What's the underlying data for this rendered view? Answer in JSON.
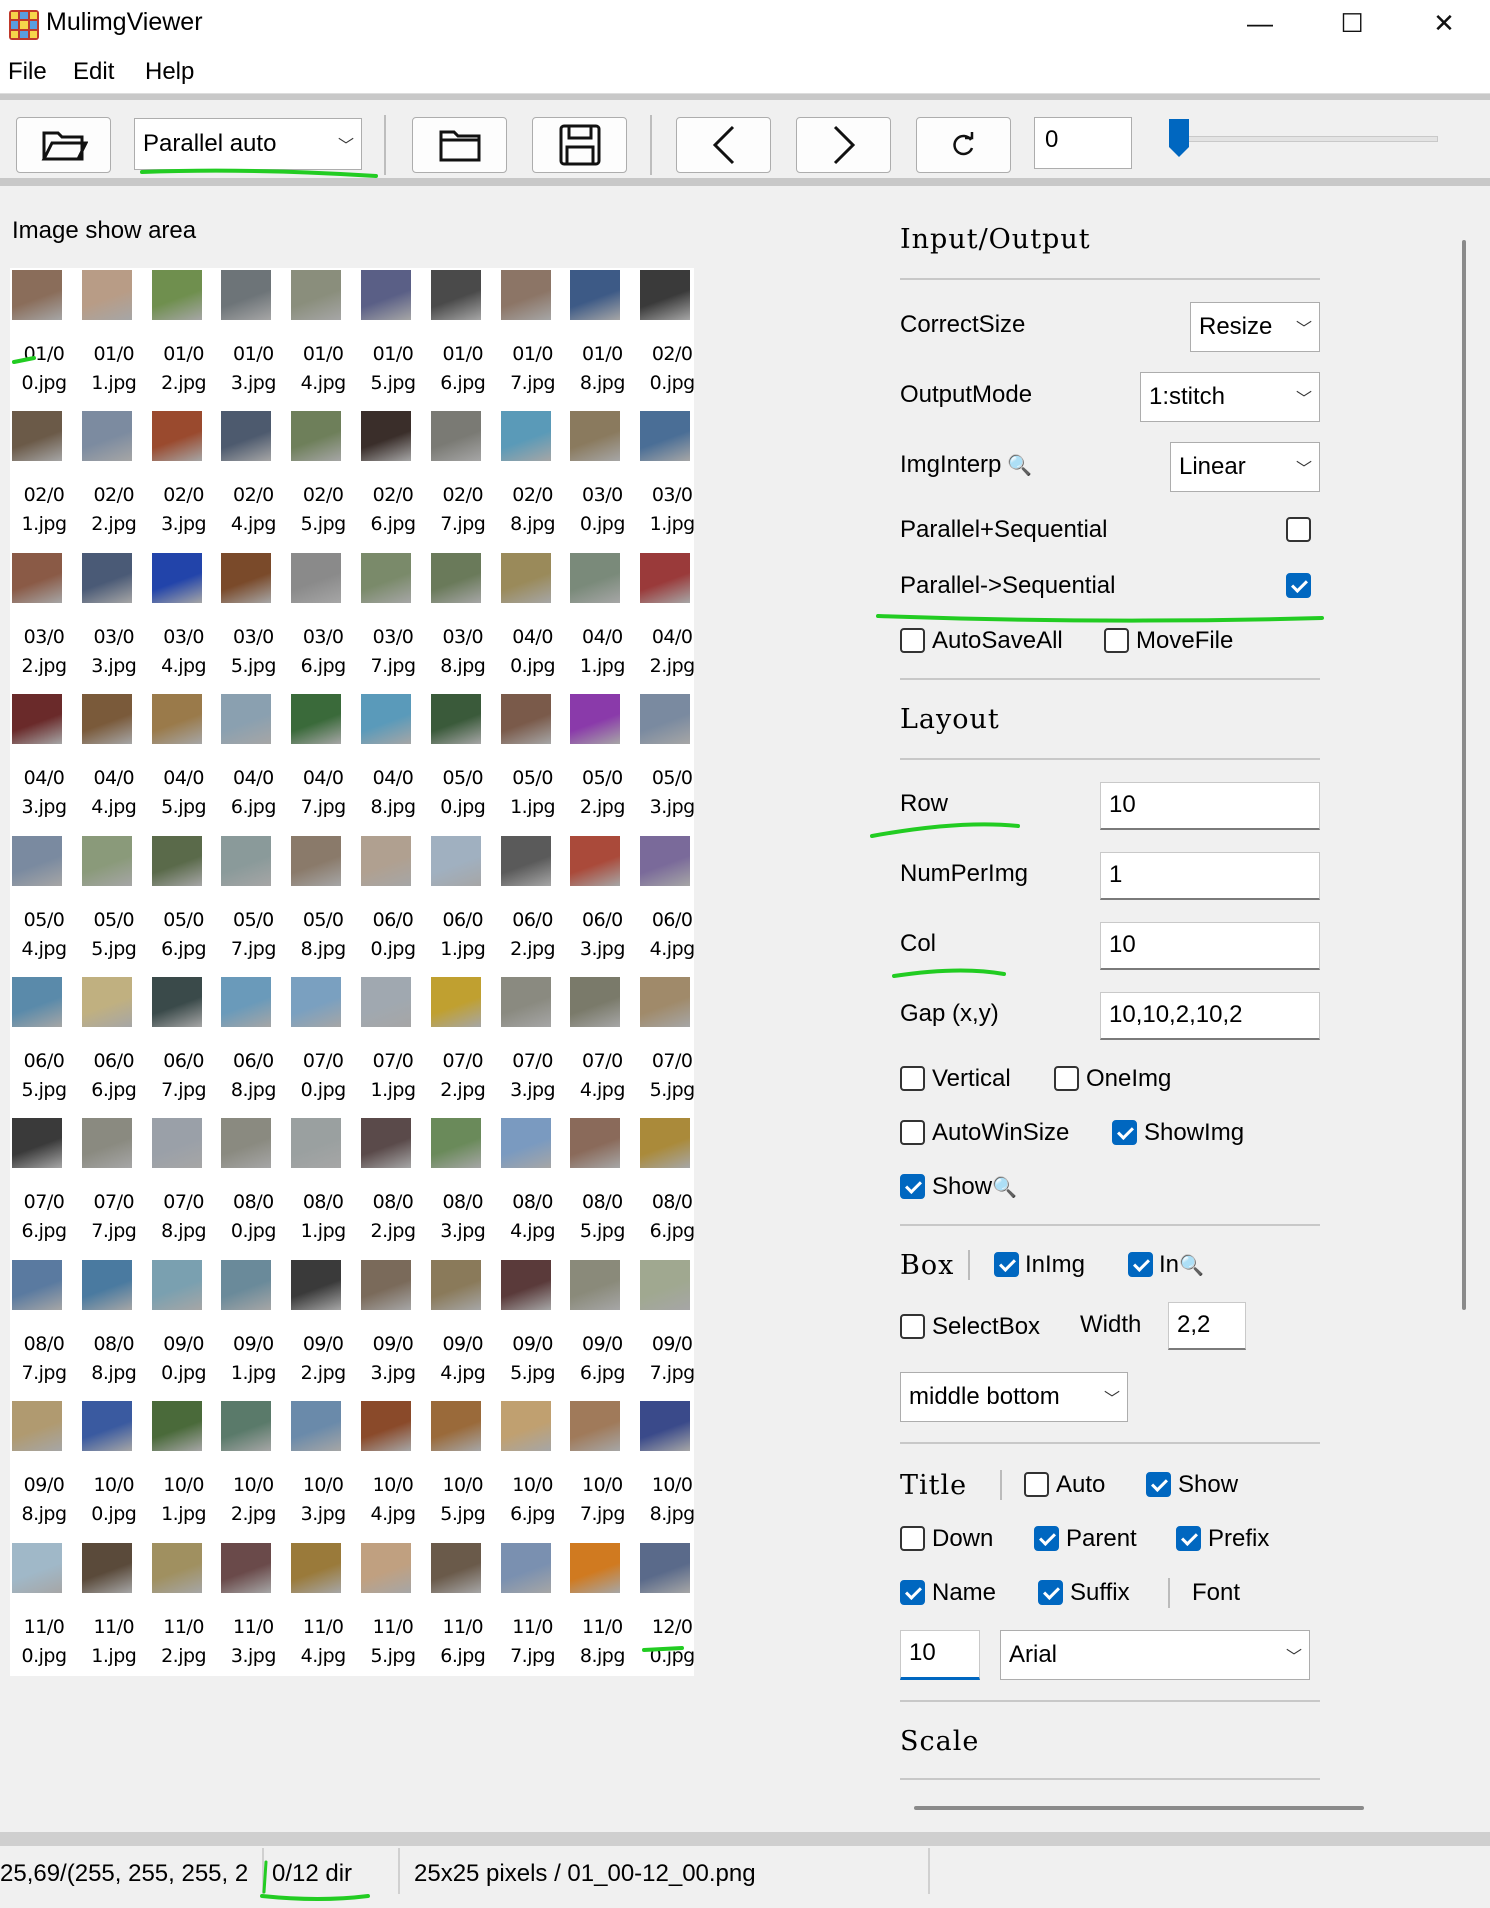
{
  "window": {
    "title": "MulimgViewer",
    "minimize": "—",
    "maximize": "☐",
    "close": "✕"
  },
  "menu": [
    "File",
    "Edit",
    "Help"
  ],
  "toolbar": {
    "mode_value": "Parallel auto",
    "spin_value": "0",
    "slider_level": 0.0
  },
  "image_area": {
    "label": "Image show area",
    "captions": [
      [
        "01/0\n0.jpg",
        "01/0\n1.jpg",
        "01/0\n2.jpg",
        "01/0\n3.jpg",
        "01/0\n4.jpg",
        "01/0\n5.jpg",
        "01/0\n6.jpg",
        "01/0\n7.jpg",
        "01/0\n8.jpg",
        "02/0\n0.jpg"
      ],
      [
        "02/0\n1.jpg",
        "02/0\n2.jpg",
        "02/0\n3.jpg",
        "02/0\n4.jpg",
        "02/0\n5.jpg",
        "02/0\n6.jpg",
        "02/0\n7.jpg",
        "02/0\n8.jpg",
        "03/0\n0.jpg",
        "03/0\n1.jpg"
      ],
      [
        "03/0\n2.jpg",
        "03/0\n3.jpg",
        "03/0\n4.jpg",
        "03/0\n5.jpg",
        "03/0\n6.jpg",
        "03/0\n7.jpg",
        "03/0\n8.jpg",
        "04/0\n0.jpg",
        "04/0\n1.jpg",
        "04/0\n2.jpg"
      ],
      [
        "04/0\n3.jpg",
        "04/0\n4.jpg",
        "04/0\n5.jpg",
        "04/0\n6.jpg",
        "04/0\n7.jpg",
        "04/0\n8.jpg",
        "05/0\n0.jpg",
        "05/0\n1.jpg",
        "05/0\n2.jpg",
        "05/0\n3.jpg"
      ],
      [
        "05/0\n4.jpg",
        "05/0\n5.jpg",
        "05/0\n6.jpg",
        "05/0\n7.jpg",
        "05/0\n8.jpg",
        "06/0\n0.jpg",
        "06/0\n1.jpg",
        "06/0\n2.jpg",
        "06/0\n3.jpg",
        "06/0\n4.jpg"
      ],
      [
        "06/0\n5.jpg",
        "06/0\n6.jpg",
        "06/0\n7.jpg",
        "06/0\n8.jpg",
        "07/0\n0.jpg",
        "07/0\n1.jpg",
        "07/0\n2.jpg",
        "07/0\n3.jpg",
        "07/0\n4.jpg",
        "07/0\n5.jpg"
      ],
      [
        "07/0\n6.jpg",
        "07/0\n7.jpg",
        "07/0\n8.jpg",
        "08/0\n0.jpg",
        "08/0\n1.jpg",
        "08/0\n2.jpg",
        "08/0\n3.jpg",
        "08/0\n4.jpg",
        "08/0\n5.jpg",
        "08/0\n6.jpg"
      ],
      [
        "08/0\n7.jpg",
        "08/0\n8.jpg",
        "09/0\n0.jpg",
        "09/0\n1.jpg",
        "09/0\n2.jpg",
        "09/0\n3.jpg",
        "09/0\n4.jpg",
        "09/0\n5.jpg",
        "09/0\n6.jpg",
        "09/0\n7.jpg"
      ],
      [
        "09/0\n8.jpg",
        "10/0\n0.jpg",
        "10/0\n1.jpg",
        "10/0\n2.jpg",
        "10/0\n3.jpg",
        "10/0\n4.jpg",
        "10/0\n5.jpg",
        "10/0\n6.jpg",
        "10/0\n7.jpg",
        "10/0\n8.jpg"
      ],
      [
        "11/0\n0.jpg",
        "11/0\n1.jpg",
        "11/0\n2.jpg",
        "11/0\n3.jpg",
        "11/0\n4.jpg",
        "11/0\n5.jpg",
        "11/0\n6.jpg",
        "11/0\n7.jpg",
        "11/0\n8.jpg",
        "12/0\n0.jpg"
      ]
    ],
    "thumb_colors": [
      [
        "#8a6d5a",
        "#b89c86",
        "#6f8f4e",
        "#6d7478",
        "#8a8e7c",
        "#5a5f86",
        "#4a4a4a",
        "#8c7566",
        "#3d5a86",
        "#3a3a3a"
      ],
      [
        "#6b5a48",
        "#7c8ba0",
        "#9a4a2e",
        "#4d5a6e",
        "#6e7f5a",
        "#3a2e2a",
        "#7a7a74",
        "#5a9ab8",
        "#8a7a5e",
        "#4a6e96"
      ],
      [
        "#8a5a46",
        "#4a5a76",
        "#2244aa",
        "#7a4a2a",
        "#8a8a8a",
        "#7a8a6a",
        "#6a7a5a",
        "#9a8a5a",
        "#7a8a7a",
        "#9a3a3a"
      ],
      [
        "#6a2a2a",
        "#7a5a3a",
        "#9a7a4a",
        "#8aa0b0",
        "#3a6a3a",
        "#5a9aba",
        "#3a5a3a",
        "#7a5a4a",
        "#8a3aaa",
        "#7a8aa0"
      ],
      [
        "#7a8aa0",
        "#8a9a7a",
        "#5a6a4a",
        "#8a9a9a",
        "#8a7a6a",
        "#b0a090",
        "#a0b0c0",
        "#5a5a5a",
        "#aa4a3a",
        "#7a6a9a"
      ],
      [
        "#5a8aaa",
        "#c0b080",
        "#3a4a4a",
        "#6a9aba",
        "#7aa0c0",
        "#a0a8b0",
        "#c0a030",
        "#8a8a80",
        "#7a7a6a",
        "#a08a6a"
      ],
      [
        "#3a3a3a",
        "#8a8a80",
        "#9aa0a8",
        "#8a8a80",
        "#9aa0a0",
        "#5a4a4a",
        "#6a8a5a",
        "#7a9ac0",
        "#8a6a5a",
        "#aa8a3a"
      ],
      [
        "#5a7aa0",
        "#4a7aa0",
        "#7aa0b0",
        "#6a8a9a",
        "#3a3a3a",
        "#7a6a5a",
        "#8a7a5a",
        "#5a3a3a",
        "#8a8a7a",
        "#a0a890"
      ],
      [
        "#b09a70",
        "#3a5aa0",
        "#4a6a3a",
        "#5a7a6a",
        "#6a8aaa",
        "#8a4a2a",
        "#9a6a3a",
        "#c0a070",
        "#a07a5a",
        "#3a4a8a"
      ],
      [
        "#a0b8c8",
        "#5a4a3a",
        "#a09060",
        "#6a4a4a",
        "#9a7a3a",
        "#c0a080",
        "#6a5a4a",
        "#7a90b0",
        "#d07a20",
        "#5a6a8a"
      ]
    ]
  },
  "panel": {
    "io_title": "Input/Output",
    "correct_size_label": "CorrectSize",
    "correct_size_value": "Resize",
    "output_mode_label": "OutputMode",
    "output_mode_value": "1:stitch",
    "img_interp_label": "ImgInterp",
    "img_interp_value": "Linear",
    "par_seq_label": "Parallel+Sequential",
    "par_seq_checked": false,
    "par_to_seq_label": "Parallel->Sequential",
    "par_to_seq_checked": true,
    "autosaveall_label": "AutoSaveAll",
    "autosaveall_checked": false,
    "movefile_label": "MoveFile",
    "movefile_checked": false,
    "layout_title": "Layout",
    "row_label": "Row",
    "row_value": "10",
    "numperimg_label": "NumPerImg",
    "numperimg_value": "1",
    "col_label": "Col",
    "col_value": "10",
    "gap_label": "Gap (x,y)",
    "gap_value": "10,10,2,10,2",
    "vertical_label": "Vertical",
    "vertical_checked": false,
    "oneimg_label": "OneImg",
    "oneimg_checked": false,
    "autowinsize_label": "AutoWinSize",
    "autowinsize_checked": false,
    "showimg_label": "ShowImg",
    "showimg_checked": true,
    "show_label": "Show",
    "show_checked": true,
    "box_title": "Box",
    "inimg_label": "InImg",
    "inimg_checked": true,
    "in_label": "In",
    "in_checked": true,
    "selectbox_label": "SelectBox",
    "selectbox_checked": false,
    "width_label": "Width",
    "width_value": "2,2",
    "position_value": "middle bottom",
    "title_title": "Title",
    "auto_label": "Auto",
    "auto_checked": false,
    "tshow_label": "Show",
    "tshow_checked": true,
    "down_label": "Down",
    "down_checked": false,
    "parent_label": "Parent",
    "parent_checked": true,
    "prefix_label": "Prefix",
    "prefix_checked": true,
    "name_label": "Name",
    "name_checked": true,
    "suffix_label": "Suffix",
    "suffix_checked": true,
    "font_label": "Font",
    "font_size_value": "10",
    "font_value": "Arial",
    "scale_title": "Scale"
  },
  "status": {
    "pixel": "25,69/(255, 255, 255, 2",
    "dir": "0/12 dir",
    "info": "25x25 pixels / 01_00-12_00.png"
  },
  "colors": {
    "accent": "#0067c0",
    "annotation": "#22cc22"
  }
}
